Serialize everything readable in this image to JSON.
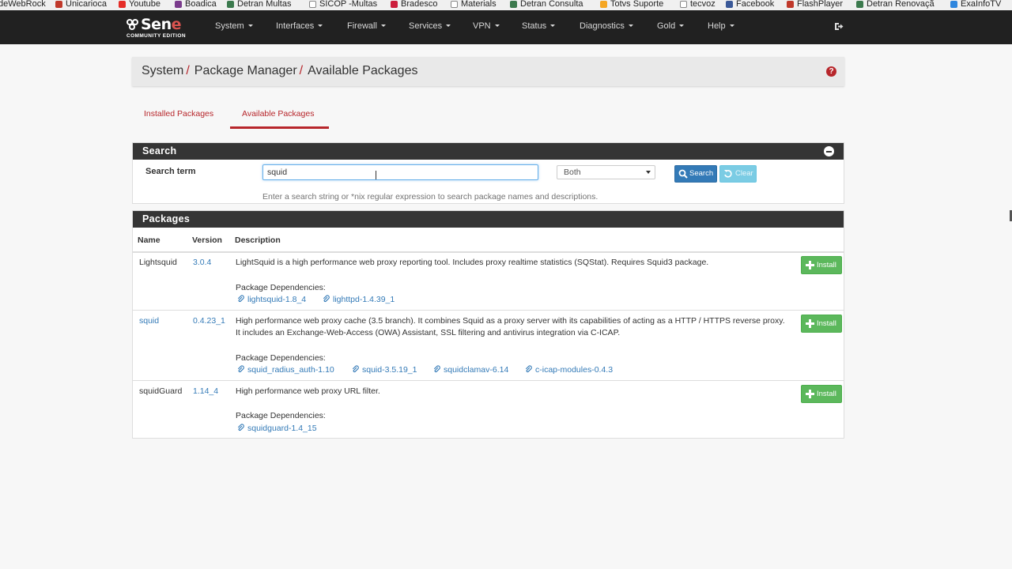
{
  "bookmarks": [
    {
      "label": "deWebRock",
      "color": "#ffffff"
    },
    {
      "label": "Unicarioca",
      "color": "#c0392b"
    },
    {
      "label": "Youtube",
      "color": "#e52d27"
    },
    {
      "label": "Boadica",
      "color": "#7a3b8c"
    },
    {
      "label": "Detran Multas",
      "color": "#3c7a4e"
    },
    {
      "label": "SICOP -Multas",
      "color": "#888888"
    },
    {
      "label": "Bradesco",
      "color": "#cc1e3c"
    },
    {
      "label": "Materials",
      "color": "#888888"
    },
    {
      "label": "Detran Consulta",
      "color": "#3c7a4e"
    },
    {
      "label": "Totvs Suporte",
      "color": "#f5a623"
    },
    {
      "label": "tecvoz",
      "color": "#888888"
    },
    {
      "label": "Facebook",
      "color": "#3b5998"
    },
    {
      "label": "FlashPlayer",
      "color": "#c0392b"
    },
    {
      "label": "Detran Renovaçã",
      "color": "#3c7a4e"
    },
    {
      "label": "ExaInfoTV",
      "color": "#2e86de"
    }
  ],
  "logo": {
    "word_a": "Sen",
    "word_b": "e",
    "subtitle": "COMMUNITY EDITION"
  },
  "nav": [
    "System",
    "Interfaces",
    "Firewall",
    "Services",
    "VPN",
    "Status",
    "Diagnostics",
    "Gold",
    "Help"
  ],
  "breadcrumb": {
    "part1": "System",
    "part2": "Package Manager",
    "part3": "Available Packages",
    "sep": "/",
    "help": "?"
  },
  "tabs": {
    "installed": "Installed Packages",
    "available": "Available Packages"
  },
  "search": {
    "title": "Search",
    "term_label": "Search term",
    "term_value": "squid",
    "scope_value": "Both",
    "search_btn": "Search",
    "clear_btn": "Clear",
    "help": "Enter a search string or *nix regular expression to search package names and descriptions."
  },
  "packages": {
    "title": "Packages",
    "col_name": "Name",
    "col_version": "Version",
    "col_desc": "Description",
    "deps_label": "Package Dependencies:",
    "install_label": "Install",
    "rows": [
      {
        "name": "Lightsquid",
        "version": "3.0.4",
        "desc": "LightSquid is a high performance web proxy reporting tool. Includes proxy realtime statistics (SQStat). Requires Squid3 package.",
        "deps": [
          "lightsquid-1.8_4",
          "lighttpd-1.4.39_1"
        ]
      },
      {
        "name": "squid",
        "version": "0.4.23_1",
        "desc": "High performance web proxy cache (3.5 branch). It combines Squid as a proxy server with its capabilities of acting as a HTTP / HTTPS reverse proxy. It includes an Exchange-Web-Access (OWA) Assistant, SSL filtering and antivirus integration via C-ICAP.",
        "deps": [
          "squid_radius_auth-1.10",
          "squid-3.5.19_1",
          "squidclamav-6.14",
          "c-icap-modules-0.4.3"
        ]
      },
      {
        "name": "squidGuard",
        "version": "1.14_4",
        "desc": "High performance web proxy URL filter.",
        "deps": [
          "squidguard-1.4_15"
        ]
      }
    ]
  },
  "colors": {
    "accent": "#b7262b",
    "link": "#337ab7",
    "install": "#5cb85c",
    "navbar": "#212121"
  }
}
